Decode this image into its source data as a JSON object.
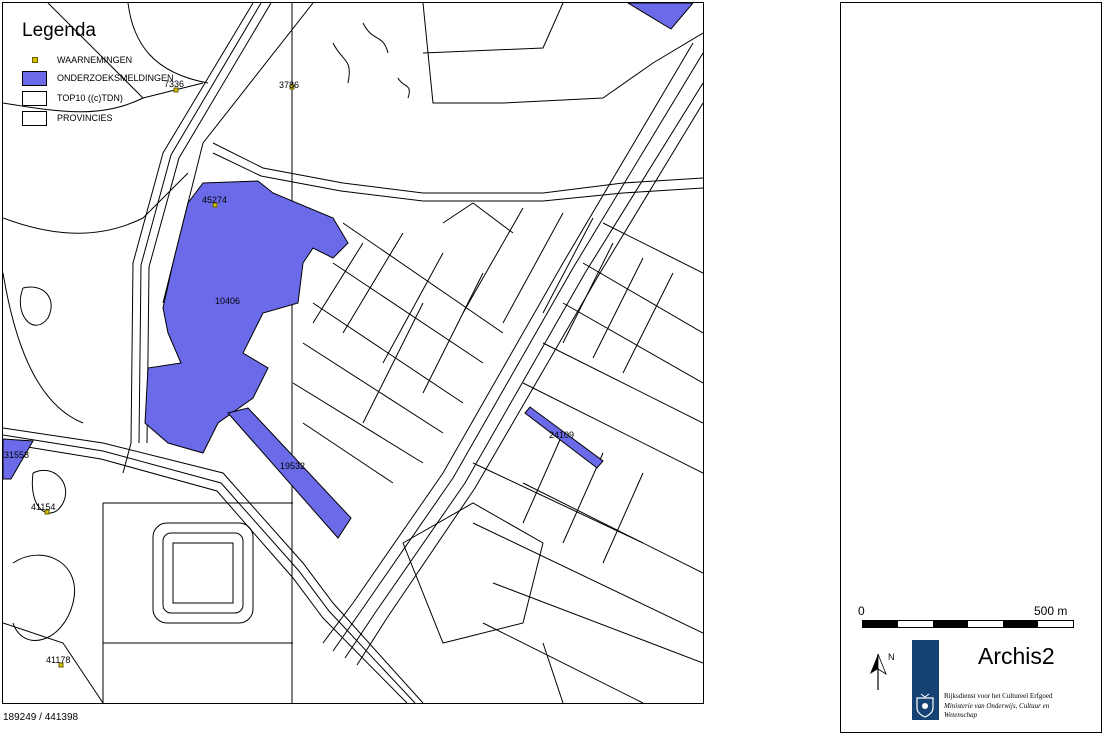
{
  "coordinates": "189249 / 441398",
  "map": {
    "colors": {
      "research_area": "#6b6bea",
      "observation": "#d4c200"
    },
    "research_area_labels": [
      "10406",
      "19532",
      "24109",
      "31558"
    ],
    "observation_labels": [
      "7336",
      "3786",
      "45274",
      "41154",
      "41178"
    ]
  },
  "legend": {
    "title": "Legenda",
    "items": [
      {
        "label": "WAARNEMINGEN",
        "icon": "observation-dot-icon"
      },
      {
        "label": "ONDERZOEKSMELDINGEN",
        "icon": "research-area-swatch"
      },
      {
        "label": "TOP10 ((c)TDN)",
        "icon": "topo-swatch"
      },
      {
        "label": "PROVINCIES",
        "icon": "province-swatch"
      }
    ]
  },
  "scale": {
    "zero": "0",
    "max": "500 m"
  },
  "north": "N",
  "branding": {
    "app": "Archis2",
    "org": "Rijksdienst voor het Cultureel Erfgoed",
    "ministry": "Ministerie van Onderwijs, Cultuur en Wetenschap"
  }
}
